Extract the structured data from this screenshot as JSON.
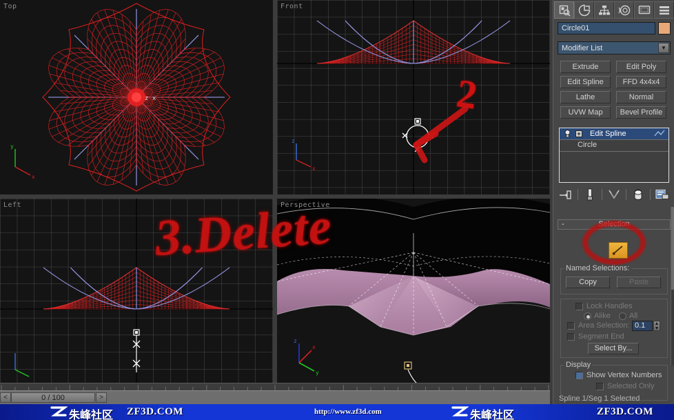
{
  "viewports": [
    {
      "key": "top",
      "label": "Top"
    },
    {
      "key": "front",
      "label": "Front"
    },
    {
      "key": "left",
      "label": "Left"
    },
    {
      "key": "persp",
      "label": "Perspective"
    }
  ],
  "annotations": {
    "delete_note": "3.Delete",
    "step_two": "2"
  },
  "timebar": {
    "prev_label": "<",
    "next_label": ">",
    "current_frame": "0 / 100"
  },
  "command_panel": {
    "tabs": [
      {
        "name": "create-tab",
        "icon": "create-icon",
        "selected": true
      },
      {
        "name": "modify-tab",
        "icon": "modify-icon",
        "selected": false
      },
      {
        "name": "hierarchy-tab",
        "icon": "hierarchy-icon",
        "selected": false
      },
      {
        "name": "motion-tab",
        "icon": "motion-icon",
        "selected": false
      },
      {
        "name": "display-tab",
        "icon": "display-icon",
        "selected": false
      },
      {
        "name": "utilities-tab",
        "icon": "utilities-icon",
        "selected": false
      }
    ],
    "object_name": "Circle01",
    "object_color": "#e8a878",
    "modifier_list_label": "Modifier List",
    "modifier_buttons": [
      "Extrude",
      "Edit Poly",
      "Edit Spline",
      "FFD 4x4x4",
      "Lathe",
      "Normal",
      "UVW Map",
      "Bevel Profile"
    ],
    "stack": [
      {
        "label": "Edit Spline",
        "selected": true,
        "has_expand": true,
        "has_bulb": true
      },
      {
        "label": "Circle",
        "selected": false,
        "has_expand": false,
        "has_bulb": false
      }
    ],
    "stack_tools": [
      "pin-stack-icon",
      "show-end-result-icon",
      "make-unique-icon",
      "remove-modifier-icon",
      "configure-sets-icon"
    ],
    "selection_rollout": {
      "title": "Selection",
      "collapse_glyph": "-",
      "sub_object_icon": "vertex-sub-object-icon",
      "named_selections_label": "Named Selections:",
      "copy_label": "Copy",
      "paste_label": "Paste",
      "lock_handles_label": "Lock Handles",
      "alike_label": "Alike",
      "all_label": "All",
      "area_selection_label": "Area Selection:",
      "area_selection_value": "0.1",
      "segment_end_label": "Segment End",
      "select_by_label": "Select By...",
      "display_group_label": "Display",
      "show_vertex_numbers_label": "Show Vertex Numbers",
      "selected_only_label": "Selected Only",
      "status_text": "Spline 1/Seg 1 Selected"
    }
  },
  "banner": {
    "cn_left": "朱峰社区",
    "en_left": "ZF3D.COM",
    "url": "http://www.zf3d.com",
    "cn_right": "朱峰社区",
    "en_right": "ZF3D.COM"
  },
  "colors": {
    "viewport_bg": "#141414",
    "panel_bg": "#474747",
    "wire_red": "#e02020",
    "wire_blue": "#8f8fd8",
    "umbrella_fabric": "#b98fb0",
    "annot_red": "#cc1414",
    "banner_blue": "#1436d6",
    "selected_stack": "#2b4a7a"
  }
}
